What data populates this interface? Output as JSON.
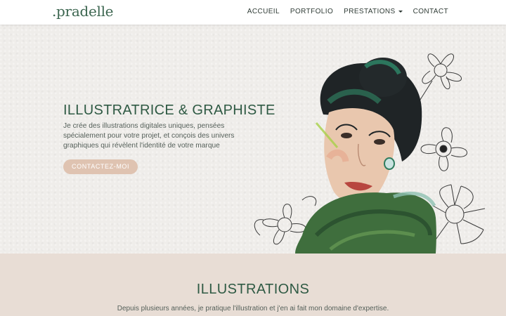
{
  "header": {
    "logo": ".pradelle",
    "nav": [
      {
        "label": "ACCUEIL"
      },
      {
        "label": "PORTFOLIO"
      },
      {
        "label": "PRESTATIONS"
      },
      {
        "label": "CONTACT"
      }
    ]
  },
  "hero": {
    "title": "ILLUSTRATRICE & GRAPHISTE",
    "description": "Je crée des illustrations digitales uniques, pensées spécialement pour votre projet, et conçois des univers graphiques qui révèlent l'identité de votre marque",
    "cta_label": "CONTACTEZ-MOI"
  },
  "section": {
    "title": "ILLUSTRATIONS",
    "description": "Depuis plusieurs années, je pratique l'illustration et j'en ai fait mon domaine d'expertise."
  },
  "colors": {
    "brand_green": "#2f5a44",
    "cta_beige": "#dfc3b1",
    "section_bg": "#e8ddd5",
    "hero_bg": "#efedea"
  }
}
